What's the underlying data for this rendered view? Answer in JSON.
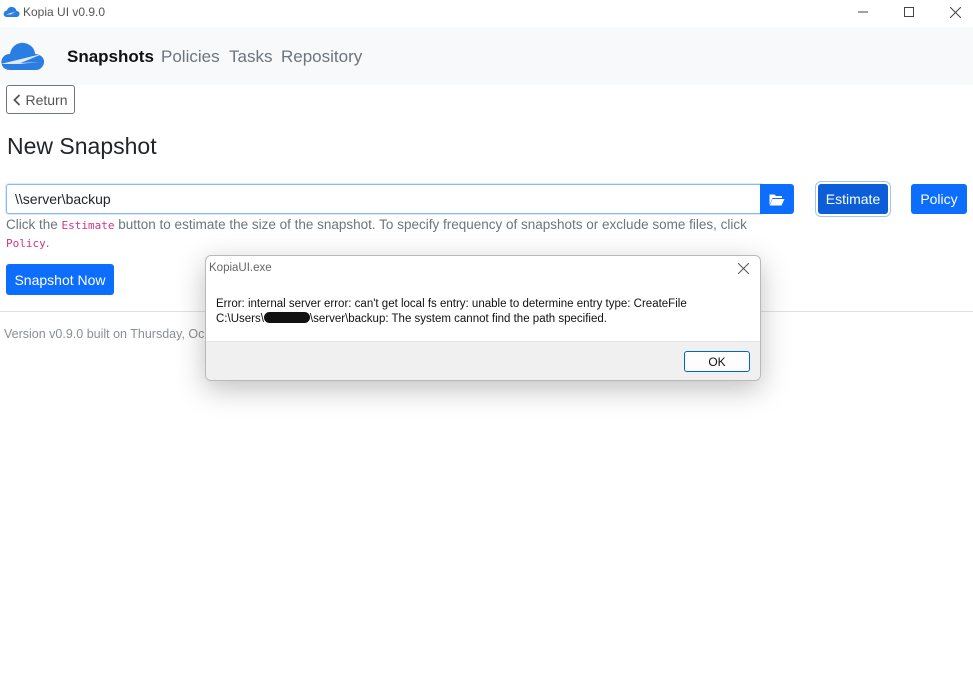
{
  "window": {
    "title": "Kopia UI v0.9.0"
  },
  "nav": {
    "items": [
      {
        "label": "Snapshots",
        "active": true
      },
      {
        "label": "Policies",
        "active": false
      },
      {
        "label": "Tasks",
        "active": false
      },
      {
        "label": "Repository",
        "active": false
      }
    ]
  },
  "page": {
    "return_label": "Return",
    "title": "New Snapshot",
    "path_value": "\\\\server\\backup",
    "estimate_label": "Estimate",
    "policy_label": "Policy",
    "help": {
      "part1": "Click the ",
      "code1": "Estimate",
      "part2": " button to estimate the size of the snapshot. To specify frequency of snapshots or exclude some files, click ",
      "code2": "Policy",
      "part3": "."
    },
    "snapshot_now_label": "Snapshot Now",
    "version_text": "Version v0.9.0 built on Thursday, Oc"
  },
  "dialog": {
    "title": "KopiaUI.exe",
    "message_line1": "Error: internal server error: can't get local fs entry: unable to determine entry type: CreateFile",
    "message_line2_prefix": "C:\\Users\\",
    "message_line2_suffix": "\\server\\backup: The system cannot find the path specified.",
    "ok_label": "OK"
  },
  "colors": {
    "primary": "#0d6efd",
    "primary_focus": "#0b5ed7",
    "code": "#d63384"
  },
  "icons": [
    "kopia-logo-icon",
    "minimize-icon",
    "maximize-icon",
    "close-icon",
    "chevron-left-icon",
    "folder-open-icon",
    "dialog-close-icon"
  ]
}
